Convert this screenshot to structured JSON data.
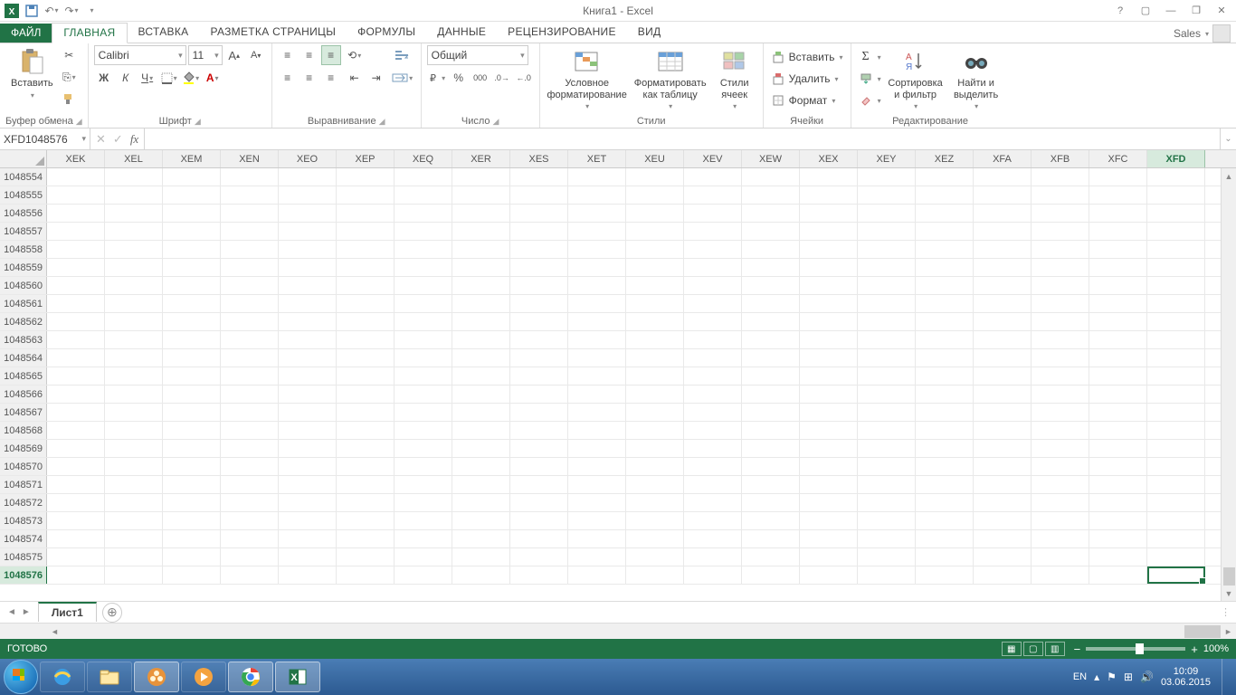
{
  "title": "Книга1 - Excel",
  "account": {
    "name": "Sales"
  },
  "tabs": {
    "file": "ФАЙЛ",
    "list": [
      "ГЛАВНАЯ",
      "ВСТАВКА",
      "РАЗМЕТКА СТРАНИЦЫ",
      "ФОРМУЛЫ",
      "ДАННЫЕ",
      "РЕЦЕНЗИРОВАНИЕ",
      "ВИД"
    ],
    "active_index": 0
  },
  "ribbon": {
    "clipboard": {
      "paste": "Вставить",
      "label": "Буфер обмена"
    },
    "font": {
      "name": "Calibri",
      "size": "11",
      "label": "Шрифт",
      "bold": "Ж",
      "italic": "К",
      "underline": "Ч"
    },
    "alignment": {
      "label": "Выравнивание"
    },
    "number": {
      "format": "Общий",
      "label": "Число"
    },
    "styles": {
      "cond": "Условное форматирование",
      "table": "Форматировать как таблицу",
      "cell": "Стили ячеек",
      "label": "Стили"
    },
    "cells": {
      "insert": "Вставить",
      "delete": "Удалить",
      "format": "Формат",
      "label": "Ячейки"
    },
    "editing": {
      "sort": "Сортировка и фильтр",
      "find": "Найти и выделить",
      "label": "Редактирование"
    }
  },
  "namebox": "XFD1048576",
  "columns": [
    "XEK",
    "XEL",
    "XEM",
    "XEN",
    "XEO",
    "XEP",
    "XEQ",
    "XER",
    "XES",
    "XET",
    "XEU",
    "XEV",
    "XEW",
    "XEX",
    "XEY",
    "XEZ",
    "XFA",
    "XFB",
    "XFC",
    "XFD"
  ],
  "active_col": "XFD",
  "rows": [
    1048554,
    1048555,
    1048556,
    1048557,
    1048558,
    1048559,
    1048560,
    1048561,
    1048562,
    1048563,
    1048564,
    1048565,
    1048566,
    1048567,
    1048568,
    1048569,
    1048570,
    1048571,
    1048572,
    1048573,
    1048574,
    1048575,
    1048576
  ],
  "active_row": 1048576,
  "sheet": {
    "name": "Лист1"
  },
  "status": {
    "ready": "ГОТОВО",
    "zoom": "100%"
  },
  "taskbar": {
    "lang": "EN",
    "time": "10:09",
    "date": "03.06.2015"
  }
}
